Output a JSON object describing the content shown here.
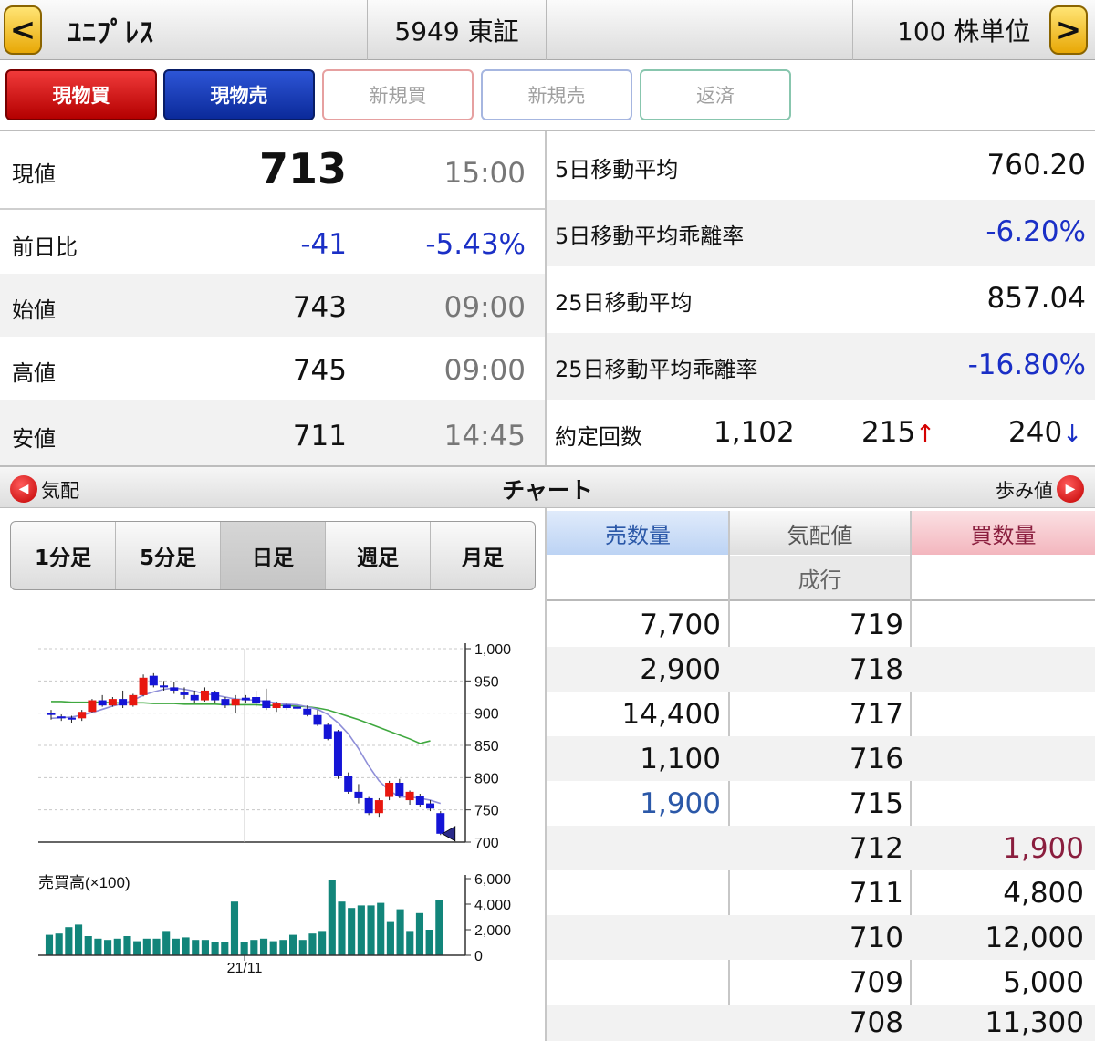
{
  "header": {
    "back_icon": "<",
    "stock_name": "ﾕﾆﾌﾟﾚｽ",
    "code_market": "5949 東証",
    "unit": "100 株単位",
    "forward_icon": ">"
  },
  "order_buttons": [
    "現物買",
    "現物売",
    "新規買",
    "新規売",
    "返済"
  ],
  "quote": {
    "current": {
      "label": "現値",
      "value": "713",
      "time": "15:00"
    },
    "change": {
      "label": "前日比",
      "value": "-41",
      "pct": "-5.43%"
    },
    "open": {
      "label": "始値",
      "value": "743",
      "time": "09:00"
    },
    "high": {
      "label": "高値",
      "value": "745",
      "time": "09:00"
    },
    "low": {
      "label": "安値",
      "value": "711",
      "time": "14:45"
    }
  },
  "moving_avg": {
    "ma5": {
      "label": "5日移動平均",
      "value": "760.20"
    },
    "ma5_dev": {
      "label": "5日移動平均乖離率",
      "value": "-6.20%"
    },
    "ma25": {
      "label": "25日移動平均",
      "value": "857.04"
    },
    "ma25_dev": {
      "label": "25日移動平均乖離率",
      "value": "-16.80%"
    }
  },
  "trades": {
    "label": "約定回数",
    "total": "1,102",
    "up": "215",
    "up_arrow": "↑",
    "down": "240",
    "down_arrow": "↓"
  },
  "section": {
    "left_label": "気配",
    "title": "チャート",
    "right_label": "歩み値",
    "left_icon": "◀",
    "right_icon": "▶"
  },
  "periods": [
    "1分足",
    "5分足",
    "日足",
    "週足",
    "月足"
  ],
  "active_period": 2,
  "chart_data": [
    {
      "type": "candlestick",
      "ylim": [
        700,
        1000
      ],
      "yticks": [
        "1,000",
        "950",
        "900",
        "850",
        "800",
        "750",
        "700"
      ],
      "x_tick_label": "21/11",
      "candles": [
        {
          "o": 900,
          "h": 905,
          "l": 890,
          "c": 898
        },
        {
          "o": 895,
          "h": 898,
          "l": 888,
          "c": 892
        },
        {
          "o": 893,
          "h": 896,
          "l": 885,
          "c": 890
        },
        {
          "o": 892,
          "h": 905,
          "l": 888,
          "c": 902
        },
        {
          "o": 902,
          "h": 922,
          "l": 900,
          "c": 920
        },
        {
          "o": 920,
          "h": 928,
          "l": 910,
          "c": 912
        },
        {
          "o": 912,
          "h": 925,
          "l": 910,
          "c": 922
        },
        {
          "o": 922,
          "h": 935,
          "l": 908,
          "c": 912
        },
        {
          "o": 912,
          "h": 930,
          "l": 910,
          "c": 928
        },
        {
          "o": 928,
          "h": 960,
          "l": 926,
          "c": 955
        },
        {
          "o": 958,
          "h": 962,
          "l": 940,
          "c": 943
        },
        {
          "o": 943,
          "h": 950,
          "l": 935,
          "c": 940
        },
        {
          "o": 940,
          "h": 948,
          "l": 930,
          "c": 935
        },
        {
          "o": 932,
          "h": 940,
          "l": 922,
          "c": 928
        },
        {
          "o": 928,
          "h": 935,
          "l": 915,
          "c": 920
        },
        {
          "o": 920,
          "h": 940,
          "l": 918,
          "c": 935
        },
        {
          "o": 932,
          "h": 935,
          "l": 915,
          "c": 920
        },
        {
          "o": 922,
          "h": 925,
          "l": 908,
          "c": 912
        },
        {
          "o": 912,
          "h": 928,
          "l": 900,
          "c": 922
        },
        {
          "o": 924,
          "h": 928,
          "l": 915,
          "c": 920
        },
        {
          "o": 925,
          "h": 935,
          "l": 910,
          "c": 915
        },
        {
          "o": 920,
          "h": 938,
          "l": 905,
          "c": 908
        },
        {
          "o": 908,
          "h": 918,
          "l": 902,
          "c": 915
        },
        {
          "o": 913,
          "h": 916,
          "l": 905,
          "c": 908
        },
        {
          "o": 910,
          "h": 915,
          "l": 905,
          "c": 907
        },
        {
          "o": 907,
          "h": 912,
          "l": 895,
          "c": 897
        },
        {
          "o": 897,
          "h": 905,
          "l": 880,
          "c": 882
        },
        {
          "o": 882,
          "h": 885,
          "l": 858,
          "c": 860
        },
        {
          "o": 872,
          "h": 874,
          "l": 798,
          "c": 802
        },
        {
          "o": 802,
          "h": 808,
          "l": 775,
          "c": 778
        },
        {
          "o": 778,
          "h": 790,
          "l": 760,
          "c": 768
        },
        {
          "o": 768,
          "h": 770,
          "l": 742,
          "c": 745
        },
        {
          "o": 745,
          "h": 768,
          "l": 738,
          "c": 765
        },
        {
          "o": 770,
          "h": 795,
          "l": 765,
          "c": 792
        },
        {
          "o": 792,
          "h": 798,
          "l": 768,
          "c": 772
        },
        {
          "o": 765,
          "h": 780,
          "l": 758,
          "c": 778
        },
        {
          "o": 772,
          "h": 775,
          "l": 755,
          "c": 758
        },
        {
          "o": 760,
          "h": 765,
          "l": 748,
          "c": 752
        },
        {
          "o": 745,
          "h": 748,
          "l": 711,
          "c": 713
        }
      ],
      "ma_short": [
        892,
        893,
        894,
        897,
        901,
        906,
        911,
        915,
        920,
        928,
        933,
        937,
        939,
        937,
        934,
        930,
        928,
        925,
        922,
        921,
        920,
        918,
        916,
        914,
        913,
        910,
        906,
        898,
        885,
        868,
        845,
        818,
        795,
        780,
        770,
        770,
        768,
        765,
        760
      ],
      "ma_long": [
        918,
        918,
        917,
        917,
        917,
        917,
        916,
        916,
        916,
        916,
        915,
        915,
        915,
        914,
        914,
        914,
        914,
        913,
        913,
        913,
        913,
        912,
        912,
        912,
        911,
        910,
        908,
        905,
        900,
        895,
        890,
        884,
        878,
        872,
        866,
        860,
        853,
        857
      ]
    },
    {
      "type": "bar",
      "label": "売買高(×100)",
      "ylim": [
        0,
        6000
      ],
      "yticks": [
        "6,000",
        "4,000",
        "2,000",
        "0"
      ],
      "values": [
        1600,
        1700,
        2200,
        2400,
        1500,
        1300,
        1200,
        1300,
        1500,
        1100,
        1300,
        1300,
        1900,
        1300,
        1400,
        1200,
        1200,
        1000,
        1000,
        4200,
        1000,
        1200,
        1300,
        1100,
        1200,
        1600,
        1200,
        1700,
        1900,
        5900,
        4200,
        3700,
        3900,
        3900,
        4100,
        2600,
        3600,
        1900,
        3300,
        2000,
        4300
      ],
      "highlight_index": 29
    }
  ],
  "board": {
    "headers": {
      "sell": "売数量",
      "price": "気配値",
      "buy": "買数量"
    },
    "market_order": "成行",
    "rows": [
      {
        "sell": "7,700",
        "price": "719",
        "buy": ""
      },
      {
        "sell": "2,900",
        "price": "718",
        "buy": ""
      },
      {
        "sell": "14,400",
        "price": "717",
        "buy": ""
      },
      {
        "sell": "1,100",
        "price": "716",
        "buy": ""
      },
      {
        "sell": "1,900",
        "price": "715",
        "buy": ""
      },
      {
        "sell": "",
        "price": "712",
        "buy": "1,900"
      },
      {
        "sell": "",
        "price": "711",
        "buy": "4,800"
      },
      {
        "sell": "",
        "price": "710",
        "buy": "12,000"
      },
      {
        "sell": "",
        "price": "709",
        "buy": "5,000"
      },
      {
        "sell": "",
        "price": "708",
        "buy": "11,300"
      }
    ]
  },
  "colors": {
    "negative": "#1a2fc6",
    "up_arrow": "#d40000",
    "down_arrow": "#1a2fc6",
    "candle_up": "#e8170f",
    "candle_down": "#1414d6",
    "ma_short": "#8f8fd8",
    "ma_long": "#3fa83f",
    "volume": "#12857a",
    "best_sell": "#2b58a8",
    "best_buy": "#8a1e3e",
    "sell_head": "#cfe0f8",
    "buy_head": "#f7c9cf"
  }
}
